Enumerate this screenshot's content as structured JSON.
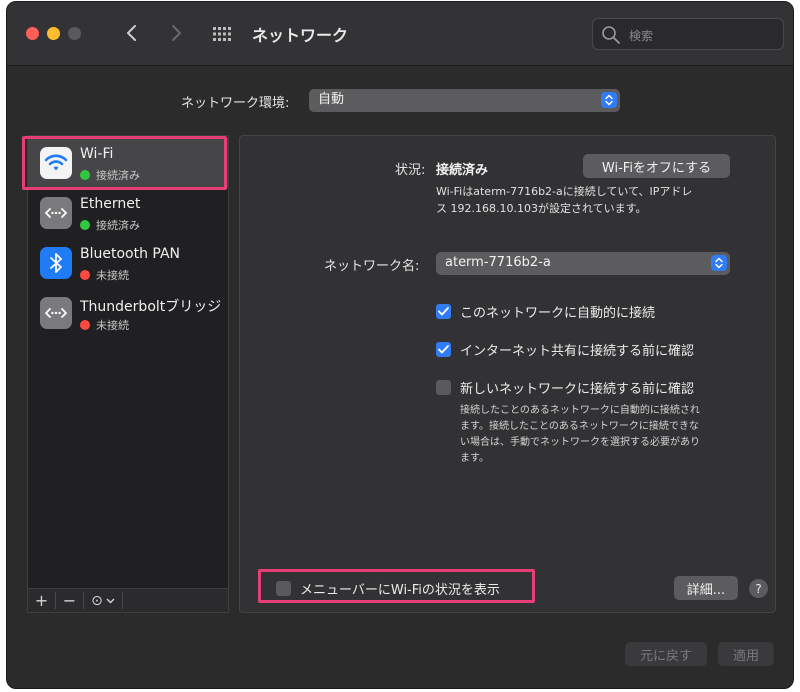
{
  "window": {
    "title": "ネットワーク"
  },
  "search": {
    "placeholder": "検索"
  },
  "location": {
    "label": "ネットワーク環境:",
    "value": "自動"
  },
  "services": [
    {
      "name": "Wi-Fi",
      "status": "接続済み",
      "status_color": "green",
      "icon": "wifi-icon",
      "selected": true
    },
    {
      "name": "Ethernet",
      "status": "接続済み",
      "status_color": "green",
      "icon": "ethernet-icon",
      "selected": false
    },
    {
      "name": "Bluetooth PAN",
      "status": "未接続",
      "status_color": "red",
      "icon": "bluetooth-icon",
      "selected": false
    },
    {
      "name": "Thunderboltブリッジ",
      "status": "未接続",
      "status_color": "red",
      "icon": "thunderbolt-bridge-icon",
      "selected": false
    }
  ],
  "sidebar_toolbar": {
    "add": "+",
    "remove": "−",
    "action": "⊙"
  },
  "detail": {
    "status_label": "状況:",
    "status_value": "接続済み",
    "toggle_button": "Wi-Fiをオフにする",
    "status_desc_1": "Wi-Fiはaterm-7716b2-aに接続していて、IPアドレ",
    "status_desc_2": "ス 192.168.10.103が設定されています。",
    "network_name_label": "ネットワーク名:",
    "network_name_value": "aterm-7716b2-a",
    "checkboxes": [
      {
        "label": "このネットワークに自動的に接続",
        "checked": true
      },
      {
        "label": "インターネット共有に接続する前に確認",
        "checked": true
      },
      {
        "label": "新しいネットワークに接続する前に確認",
        "checked": false
      }
    ],
    "ask_note_1": "接続したことのあるネットワークに自動的に接続され",
    "ask_note_2": "ます。接続したことのあるネットワークに接続できな",
    "ask_note_3": "い場合は、手動でネットワークを選択する必要があり",
    "ask_note_4": "ます。",
    "menubar_checkbox": {
      "label": "メニューバーにWi-Fiの状況を表示",
      "checked": false
    },
    "advanced_button": "詳細...",
    "help": "?"
  },
  "footer": {
    "revert": "元に戻す",
    "apply": "適用"
  },
  "colors": {
    "accent": "#2f7cf6",
    "highlight": "#e83e78",
    "connected": "#2fc840",
    "disconnected": "#fe4b42"
  }
}
